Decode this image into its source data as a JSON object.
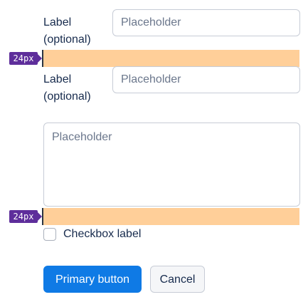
{
  "form": {
    "field1": {
      "label_line1": "Label",
      "label_line2": "(optional)",
      "placeholder": "Placeholder"
    },
    "field2": {
      "label_line1": "Label",
      "label_line2": "(optional)",
      "placeholder": "Placeholder"
    },
    "textarea": {
      "placeholder": "Placeholder"
    },
    "checkbox": {
      "label": "Checkbox label",
      "checked": false
    }
  },
  "spacing_annotations": [
    {
      "label": "24px",
      "color": "#ffcf99",
      "badge_color": "#5e2e9b"
    },
    {
      "label": "24px",
      "color": "#ffcf99",
      "badge_color": "#5e2e9b"
    }
  ],
  "actions": {
    "primary_label": "Primary button",
    "cancel_label": "Cancel"
  },
  "colors": {
    "primary": "#0f7ae5",
    "text": "#172b4d",
    "placeholder": "#6b778c",
    "border": "#c7ccd6"
  }
}
